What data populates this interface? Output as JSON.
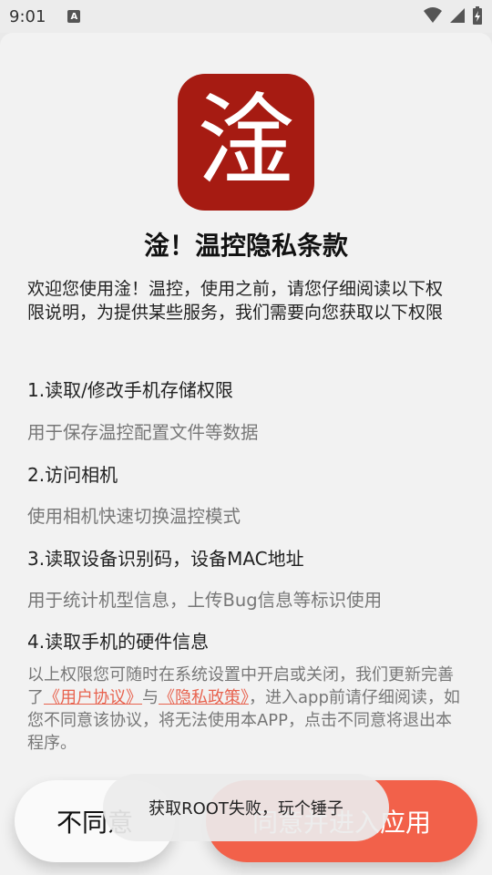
{
  "status_bar": {
    "time": "9:01",
    "notification_letter": "A"
  },
  "logo_char": "淦",
  "title": "淦！温控隐私条款",
  "intro": "欢迎您使用淦！温控，使用之前，请您仔细阅读以下权限说明，为提供某些服务，我们需要向您获取以下权限",
  "permissions": [
    {
      "title": "1.读取/修改手机存储权限",
      "desc": "用于保存温控配置文件等数据"
    },
    {
      "title": "2.访问相机",
      "desc": "使用相机快速切换温控模式"
    },
    {
      "title": "3.读取设备识别码，设备MAC地址",
      "desc": "用于统计机型信息，上传Bug信息等标识使用"
    },
    {
      "title": "4.读取手机的硬件信息",
      "desc": ""
    }
  ],
  "footer": {
    "part1": "以上权限您可随时在系统设置中开启或关闭，我们更新完善了",
    "link_user": "《用户协议》",
    "part2": "与",
    "link_privacy": "《隐私政策》",
    "part3": "，进入app前请仔细阅读，如您不同意该协议，将无法使用本APP，点击不同意将退出本程序。"
  },
  "buttons": {
    "disagree": "不同意",
    "agree": "同意并进入应用"
  },
  "toast": "获取ROOT失败，玩个锤子",
  "colors": {
    "accent": "#f2614a",
    "logo_bg": "#a61b12",
    "link": "#e8634f"
  }
}
